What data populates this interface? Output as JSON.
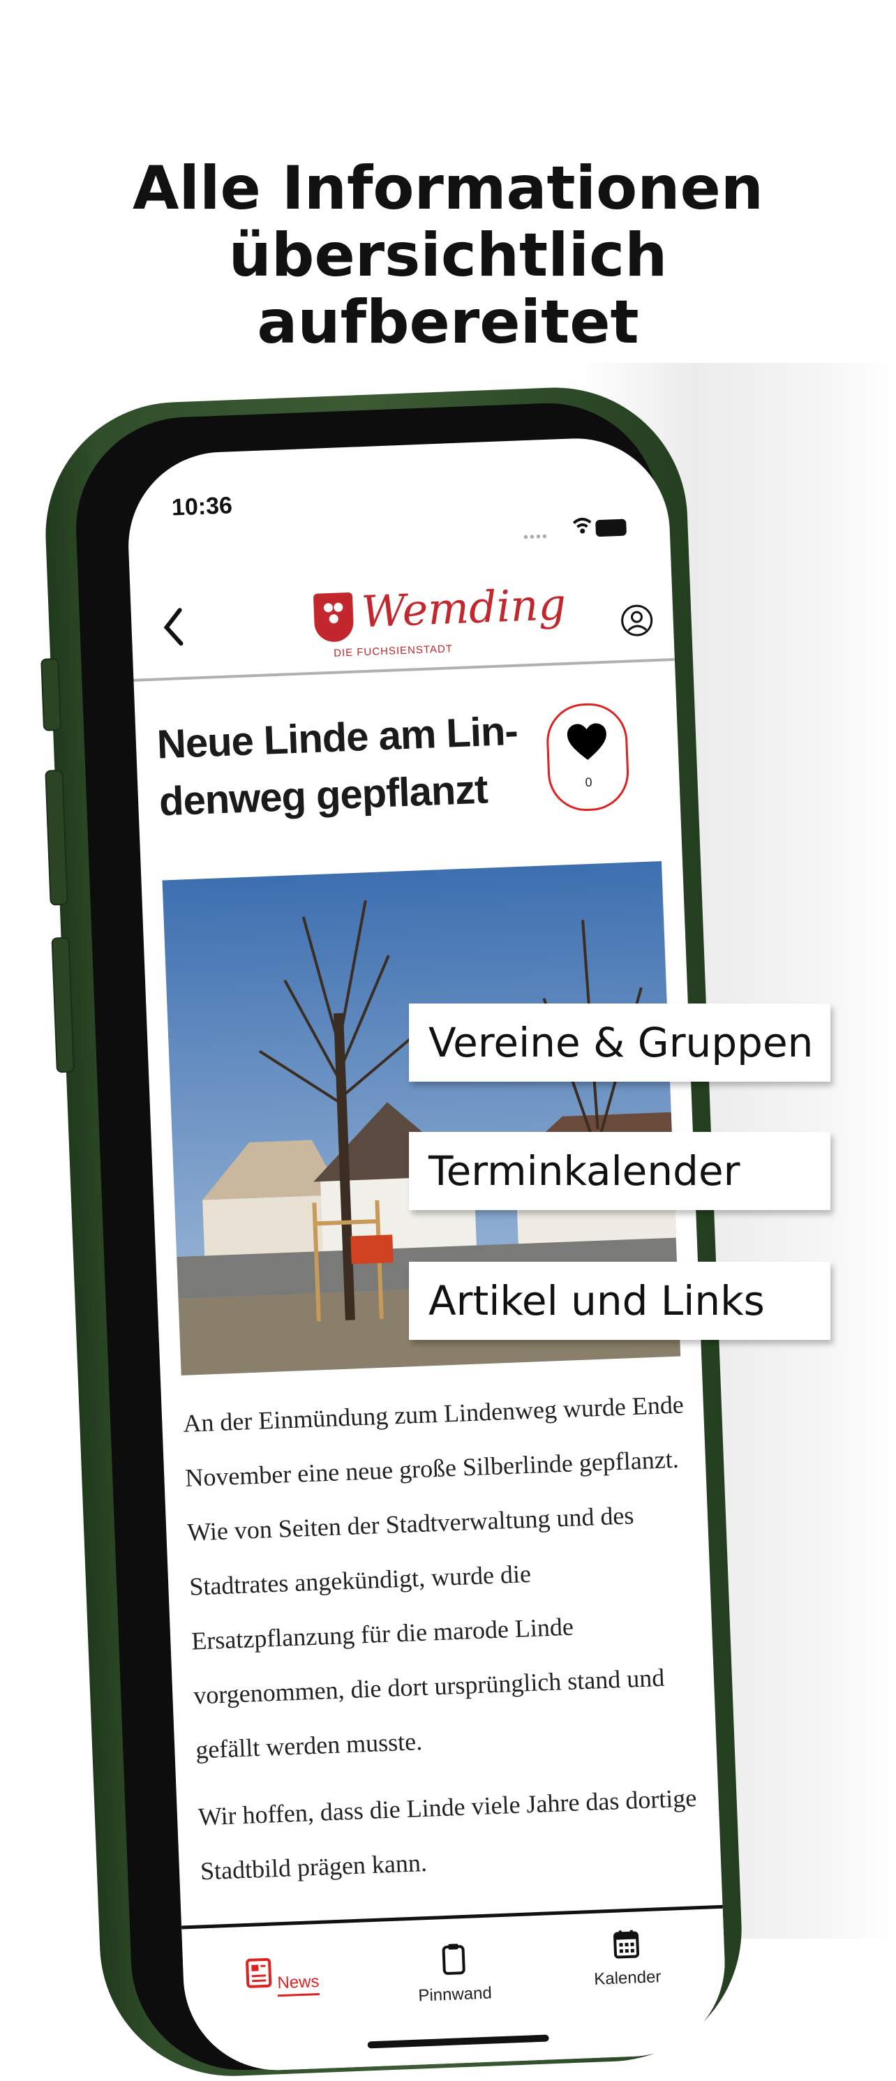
{
  "headline": {
    "line1": "Alle Informationen",
    "line2": "übersichtlich",
    "line3": "aufbereitet"
  },
  "status_bar": {
    "time": "10:36",
    "icons": [
      "signal-icon",
      "wifi-icon",
      "battery-icon"
    ]
  },
  "nav": {
    "back_icon": "chevron-left-icon",
    "logo_name": "Wemding",
    "logo_tagline": "DIE FUCHSIENSTADT",
    "profile_icon": "profile-icon"
  },
  "article": {
    "title_line1": "Neue Linde am Lin-",
    "title_line2": "denweg gepflanzt",
    "like_count": "0",
    "paragraph1": "An der Einmündung zum Lindenweg wurde Ende November eine neue große Silberlinde gepflanzt. Wie von Seiten der Stadtverwaltung und des Stadtrates angekündigt, wurde die Ersatzpflanzung für die marode Linde vorgenommen, die dort ursprünglich stand und gefällt werden musste.",
    "paragraph2": "Wir hoffen, dass die Linde viele Jahre das dortige Stadtbild prägen kann."
  },
  "tabs": [
    {
      "label": "News",
      "icon": "news-icon",
      "active": true
    },
    {
      "label": "Pinnwand",
      "icon": "clipboard-icon",
      "active": false
    },
    {
      "label": "Kalender",
      "icon": "calendar-icon",
      "active": false
    }
  ],
  "callouts": [
    {
      "label": "Vereine & Gruppen"
    },
    {
      "label": "Terminkalender"
    },
    {
      "label": "Artikel und Links"
    }
  ],
  "colors": {
    "accent": "#dd2222",
    "brand": "#c1272d",
    "phone_frame": "#3c5b34"
  }
}
